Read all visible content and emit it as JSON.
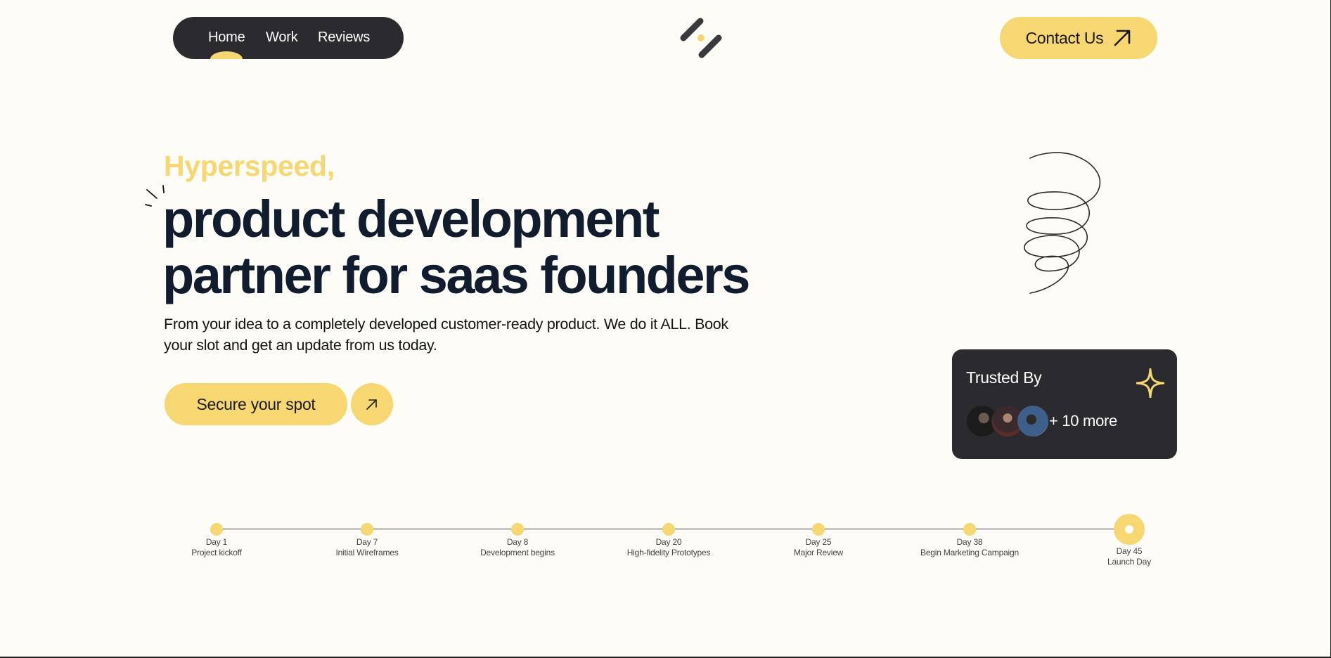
{
  "nav": {
    "items": [
      {
        "label": "Home",
        "active": true
      },
      {
        "label": "Work"
      },
      {
        "label": "Reviews"
      }
    ]
  },
  "header": {
    "logo_icon": "slash-dot-logo-icon",
    "contact_label": "Contact Us"
  },
  "hero": {
    "kicker": "Hyperspeed,",
    "headline_line1": "product development",
    "headline_line2": "partner for saas founders",
    "subtext": "From your idea to a completely developed customer-ready product. We do it ALL. Book your slot and get an update from us today.",
    "cta_label": "Secure your spot"
  },
  "trusted": {
    "title": "Trusted By",
    "more": "+ 10 more"
  },
  "timeline": [
    {
      "day": "Day 1",
      "label": "Project kickoff"
    },
    {
      "day": "Day 7",
      "label": "Initial Wireframes"
    },
    {
      "day": "Day 8",
      "label": "Development begins"
    },
    {
      "day": "Day 20",
      "label": "High-fidelity Prototypes"
    },
    {
      "day": "Day 25",
      "label": "Major Review"
    },
    {
      "day": "Day 38",
      "label": "Begin Marketing Campaign"
    },
    {
      "day": "Day 45",
      "label": "Launch Day",
      "current": true
    }
  ],
  "colors": {
    "background": "#fdfcf6",
    "accent": "#f6d772",
    "dark": "#2b2b2f",
    "heading": "#111c2f"
  }
}
